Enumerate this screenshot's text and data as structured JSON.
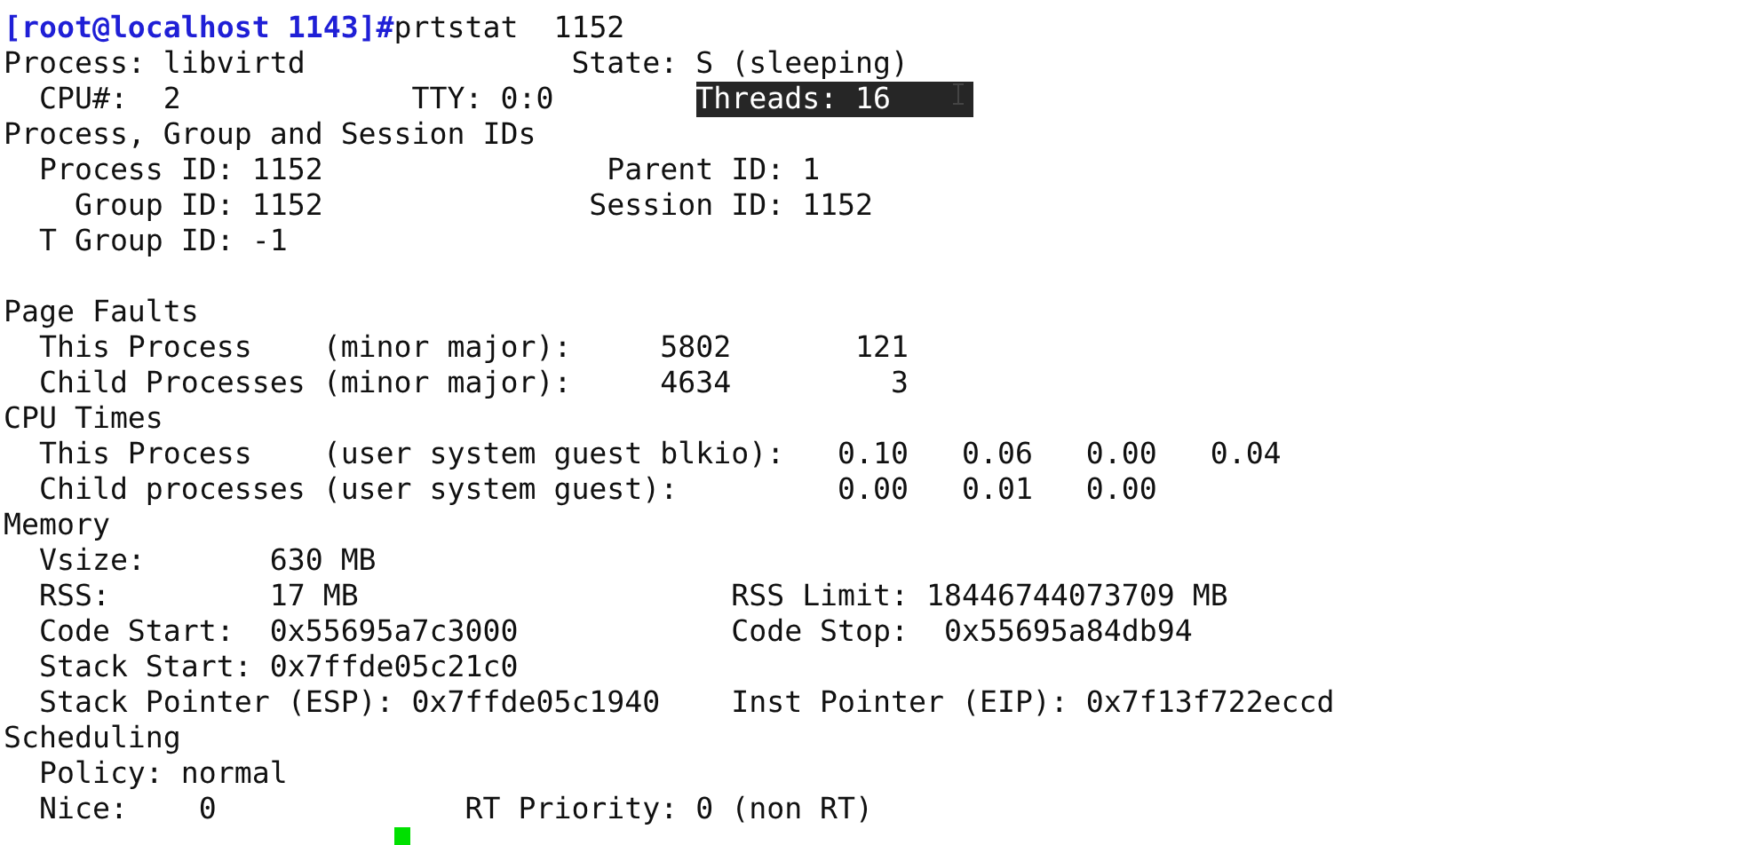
{
  "terminal": {
    "lines": [
      {
        "spans": [
          {
            "kind": "prompt",
            "text": "[root@localhost 1143]#"
          },
          {
            "kind": "text",
            "text": "prtstat  1152"
          }
        ]
      },
      {
        "spans": [
          {
            "kind": "text",
            "text": "Process: libvirtd               State: S (sleeping)"
          }
        ]
      },
      {
        "spans": [
          {
            "kind": "text",
            "text": "  CPU#:  2             TTY: 0:0        "
          },
          {
            "kind": "selection",
            "text": "Threads: 16"
          }
        ]
      },
      {
        "spans": [
          {
            "kind": "text",
            "text": "Process, Group and Session IDs"
          }
        ]
      },
      {
        "spans": [
          {
            "kind": "text",
            "text": "  Process ID: 1152                Parent ID: 1"
          }
        ]
      },
      {
        "spans": [
          {
            "kind": "text",
            "text": "    Group ID: 1152               Session ID: 1152"
          }
        ]
      },
      {
        "spans": [
          {
            "kind": "text",
            "text": "  T Group ID: -1"
          }
        ]
      },
      {
        "kind": "blank"
      },
      {
        "spans": [
          {
            "kind": "text",
            "text": "Page Faults"
          }
        ]
      },
      {
        "spans": [
          {
            "kind": "text",
            "text": "  This Process    (minor major):     5802       121"
          }
        ]
      },
      {
        "spans": [
          {
            "kind": "text",
            "text": "  Child Processes (minor major):     4634         3"
          }
        ]
      },
      {
        "spans": [
          {
            "kind": "text",
            "text": "CPU Times"
          }
        ]
      },
      {
        "spans": [
          {
            "kind": "text",
            "text": "  This Process    (user system guest blkio):   0.10   0.06   0.00   0.04"
          }
        ]
      },
      {
        "spans": [
          {
            "kind": "text",
            "text": "  Child processes (user system guest):         0.00   0.01   0.00"
          }
        ]
      },
      {
        "spans": [
          {
            "kind": "text",
            "text": "Memory"
          }
        ]
      },
      {
        "spans": [
          {
            "kind": "text",
            "text": "  Vsize:       630 MB"
          }
        ]
      },
      {
        "spans": [
          {
            "kind": "text",
            "text": "  RSS:         17 MB                     RSS Limit: 18446744073709 MB"
          }
        ]
      },
      {
        "spans": [
          {
            "kind": "text",
            "text": "  Code Start:  0x55695a7c3000            Code Stop:  0x55695a84db94"
          }
        ]
      },
      {
        "spans": [
          {
            "kind": "text",
            "text": "  Stack Start: 0x7ffde05c21c0"
          }
        ]
      },
      {
        "spans": [
          {
            "kind": "text",
            "text": "  Stack Pointer (ESP): 0x7ffde05c1940    Inst Pointer (EIP): 0x7f13f722eccd"
          }
        ]
      },
      {
        "spans": [
          {
            "kind": "text",
            "text": "Scheduling"
          }
        ]
      },
      {
        "spans": [
          {
            "kind": "text",
            "text": "  Policy: normal"
          }
        ]
      },
      {
        "spans": [
          {
            "kind": "text",
            "text": "  Nice:    0              RT Priority: 0 (non RT)"
          }
        ]
      },
      {
        "cursor": true
      }
    ]
  }
}
